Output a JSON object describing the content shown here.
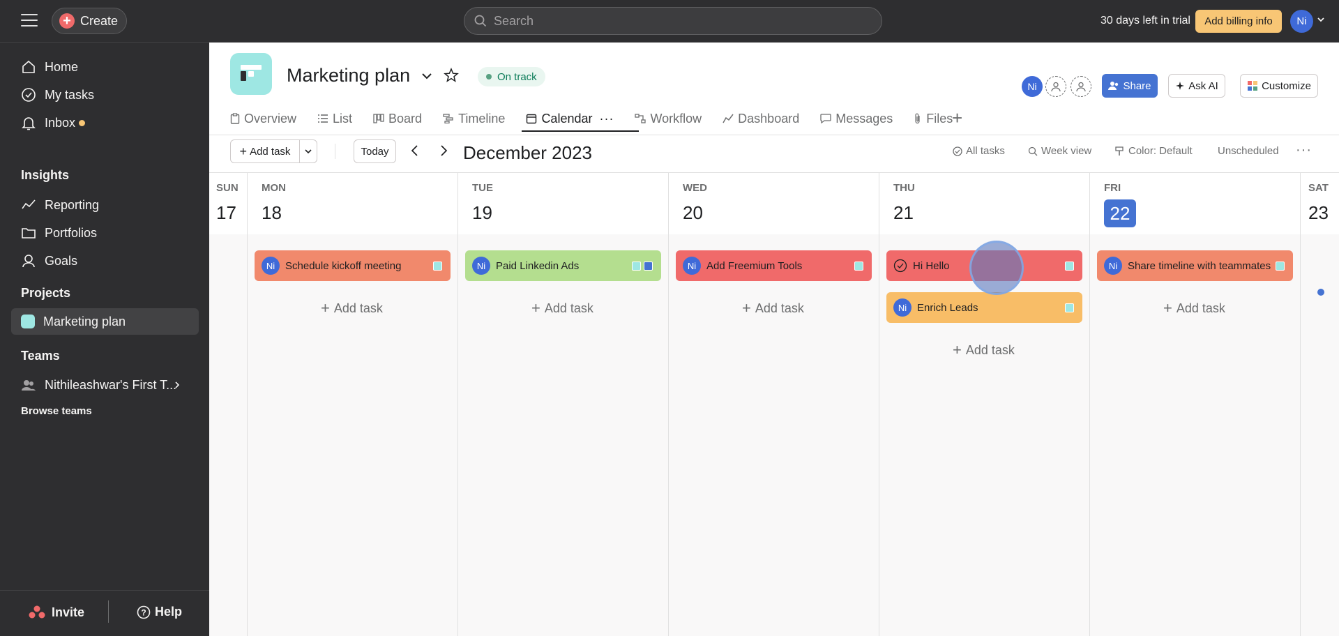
{
  "topbar": {
    "create_label": "Create",
    "search_placeholder": "Search",
    "trial_text": "30 days left in trial",
    "billing_label": "Add billing info",
    "user_initials": "Ni"
  },
  "sidebar": {
    "nav": [
      {
        "label": "Home",
        "icon": "home-icon"
      },
      {
        "label": "My tasks",
        "icon": "check-circle-icon"
      },
      {
        "label": "Inbox",
        "icon": "bell-icon"
      }
    ],
    "insights_heading": "Insights",
    "insights": [
      {
        "label": "Reporting",
        "icon": "reporting-icon"
      },
      {
        "label": "Portfolios",
        "icon": "folder-icon"
      },
      {
        "label": "Goals",
        "icon": "goals-icon"
      }
    ],
    "projects_heading": "Projects",
    "project_name": "Marketing plan",
    "teams_heading": "Teams",
    "team_name": "Nithileashwar's First T...",
    "browse_teams": "Browse teams",
    "invite_label": "Invite",
    "help_label": "Help"
  },
  "project": {
    "title": "Marketing plan",
    "status": "On track",
    "share_label": "Share",
    "ask_ai_label": "Ask AI",
    "customize_label": "Customize",
    "member_initials": "Ni",
    "tabs": [
      "Overview",
      "List",
      "Board",
      "Timeline",
      "Calendar",
      "Workflow",
      "Dashboard",
      "Messages",
      "Files"
    ],
    "active_tab": "Calendar"
  },
  "toolbar": {
    "add_task": "Add task",
    "today": "Today",
    "month": "December 2023",
    "all_tasks": "All tasks",
    "week_view": "Week view",
    "color": "Color: Default",
    "unscheduled": "Unscheduled"
  },
  "calendar": {
    "days": [
      {
        "name": "SUN",
        "num": "17"
      },
      {
        "name": "MON",
        "num": "18"
      },
      {
        "name": "TUE",
        "num": "19"
      },
      {
        "name": "WED",
        "num": "20"
      },
      {
        "name": "THU",
        "num": "21"
      },
      {
        "name": "FRI",
        "num": "22",
        "today": true
      },
      {
        "name": "SAT",
        "num": "23"
      }
    ],
    "add_task_label": "Add task",
    "tasks": [
      {
        "day": "MON",
        "title": "Schedule kickoff meeting",
        "assignee": "Ni",
        "color": "#f1896c"
      },
      {
        "day": "TUE",
        "title": "Paid Linkedin Ads",
        "assignee": "Ni",
        "color": "#b4de8f"
      },
      {
        "day": "WED",
        "title": "Add Freemium Tools",
        "assignee": "Ni",
        "color": "#f06a6a"
      },
      {
        "day": "THU",
        "title": "Hi Hello",
        "assignee": "",
        "color": "#f06a6a"
      },
      {
        "day": "THU",
        "title": "Enrich Leads",
        "assignee": "Ni",
        "color": "#f8bd67"
      },
      {
        "day": "FRI",
        "title": "Share timeline with teammates",
        "assignee": "Ni",
        "color": "#f1896c"
      }
    ]
  },
  "colors": {
    "accent": "#4573d2",
    "project": "#9ee7e3",
    "status_green": "#58a182",
    "billing": "#f8c675"
  }
}
